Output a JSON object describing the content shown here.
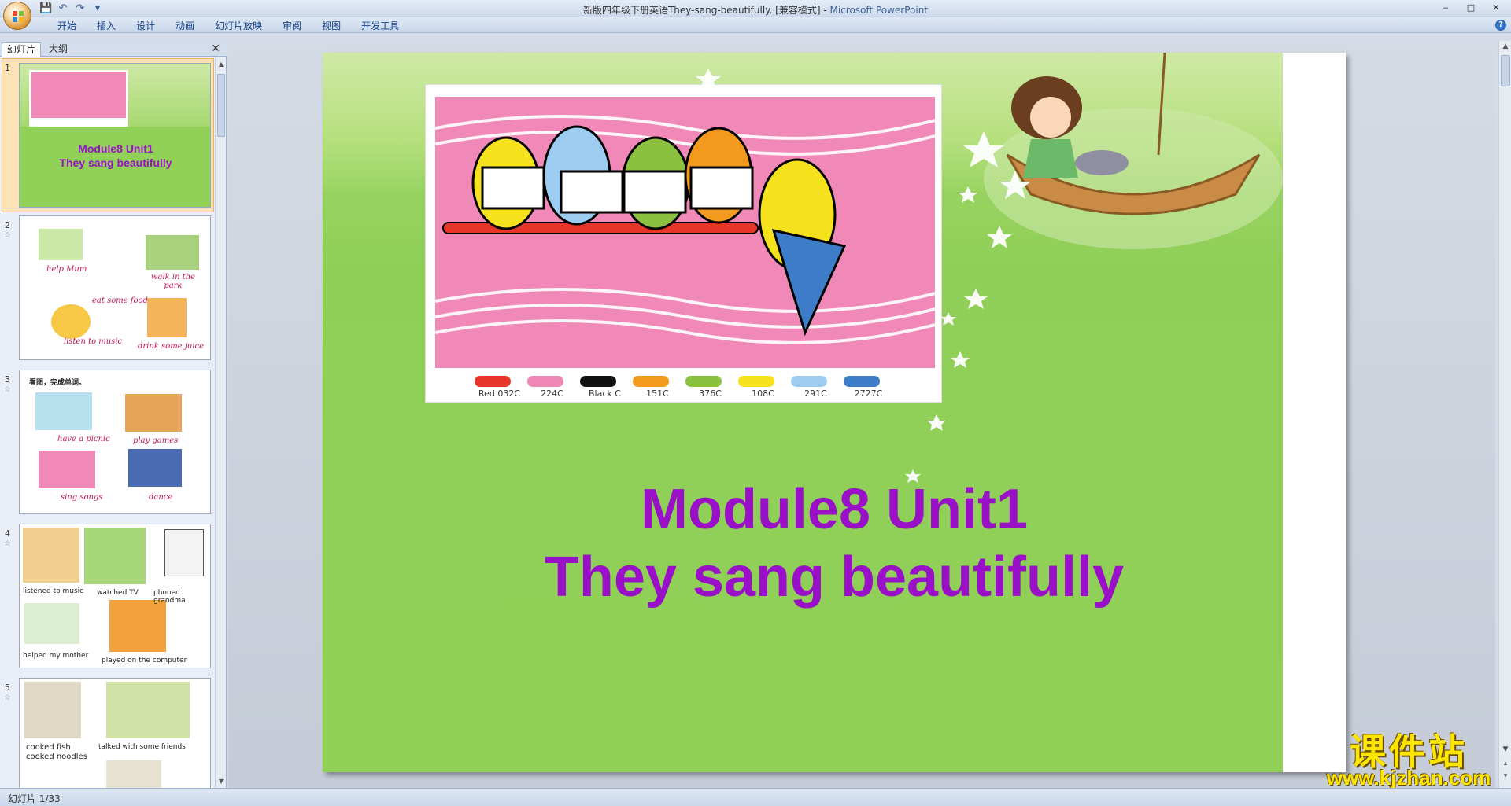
{
  "window": {
    "title": "新版四年级下册英语They-sang-beautifully. [兼容模式] - ",
    "app_name": "Microsoft PowerPoint"
  },
  "ribbon": {
    "tabs": [
      "开始",
      "插入",
      "设计",
      "动画",
      "幻灯片放映",
      "审阅",
      "视图",
      "开发工具"
    ]
  },
  "left_panel": {
    "tab_slides": "幻灯片",
    "tab_outline": "大纲",
    "thumbnails": [
      {
        "num": "1",
        "line1": "Module8 Unit1",
        "line2": "They sang beautifully"
      },
      {
        "num": "2",
        "captions": [
          "help Mum",
          "eat some food",
          "walk in the park",
          "listen to music",
          "drink some juice"
        ]
      },
      {
        "num": "3",
        "heading": "看图，完成单词。",
        "captions": [
          "have a picnic",
          "play games",
          "sing songs",
          "dance"
        ]
      },
      {
        "num": "4",
        "captions": [
          "listened to music",
          "watched TV",
          "phoned grandma",
          "helped my mother",
          "played on the computer"
        ]
      },
      {
        "num": "5",
        "captions": [
          "cooked fish",
          "cooked noodles",
          "talked with some friends"
        ]
      }
    ]
  },
  "slide": {
    "title_line1": "Module8 Unit1",
    "title_line2": "They sang beautifully",
    "swatch_labels": [
      "Red 032C",
      "224C",
      "Black C",
      "151C",
      "376C",
      "108C",
      "291C",
      "2727C"
    ],
    "swatch_colors": [
      "#e8352a",
      "#ee87b4",
      "#111111",
      "#f39a1e",
      "#8cc13f",
      "#f6e21c",
      "#9ccdf0",
      "#3d7cc9"
    ]
  },
  "watermark": {
    "cn": "课件站",
    "url": "www.kjzhan.com"
  },
  "status": {
    "slide_count": "幻灯片 1/33"
  }
}
